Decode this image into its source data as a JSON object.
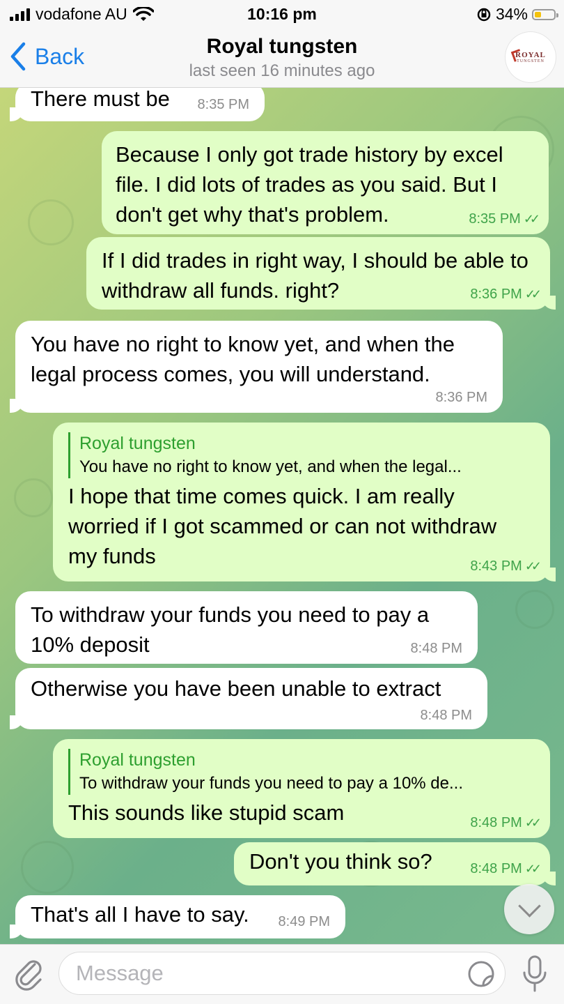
{
  "status_bar": {
    "carrier": "vodafone AU",
    "time": "10:16 pm",
    "battery_percent": "34%",
    "battery_level": 0.34,
    "battery_color": "#f4c20d",
    "icons": [
      "signal-icon",
      "wifi-icon",
      "orientation-lock-icon",
      "battery-icon"
    ]
  },
  "nav": {
    "back_label": "Back",
    "title": "Royal tungsten",
    "subtitle": "last seen 16 minutes ago",
    "avatar_text": [
      "ROYAL",
      "TUNGSTEN"
    ]
  },
  "messages": [
    {
      "direction": "in",
      "text": "There must be",
      "time": "8:35 PM"
    },
    {
      "direction": "out",
      "text": "Because I only got trade history by excel file. I did lots of trades as you said. But I don't get why that's problem.",
      "time": "8:35 PM",
      "read": true
    },
    {
      "direction": "out",
      "text": "If I did trades in right way, I should be able to withdraw all funds. right?",
      "time": "8:36 PM",
      "read": true
    },
    {
      "direction": "in",
      "text": "You have no right to know yet, and when the legal process comes, you will understand.",
      "time": "8:36 PM"
    },
    {
      "direction": "out",
      "reply_name": "Royal tungsten",
      "reply_text": "You have no right to know yet, and when the legal...",
      "text": "I hope that time comes quick. I am really worried if I got scammed or can not withdraw my funds",
      "time": "8:43 PM",
      "read": true
    },
    {
      "direction": "in",
      "text": "To withdraw your funds you need to pay a 10% deposit",
      "time": "8:48 PM"
    },
    {
      "direction": "in",
      "text": "Otherwise you have been unable to extract",
      "time": "8:48 PM"
    },
    {
      "direction": "out",
      "reply_name": "Royal tungsten",
      "reply_text": "To withdraw your funds you need to pay a 10% de...",
      "text": "This sounds like stupid scam",
      "time": "8:48 PM",
      "read": true
    },
    {
      "direction": "out",
      "text": "Don't you think so?",
      "time": "8:48 PM",
      "read": true
    },
    {
      "direction": "in",
      "text": "That's all I have to say.",
      "time": "8:49 PM"
    }
  ],
  "input": {
    "placeholder": "Message",
    "value": ""
  },
  "colors": {
    "accent": "#1a7fe8",
    "incoming_bubble": "#ffffff",
    "outgoing_bubble": "#e1fec6",
    "reply_accent": "#2d9f2f"
  }
}
